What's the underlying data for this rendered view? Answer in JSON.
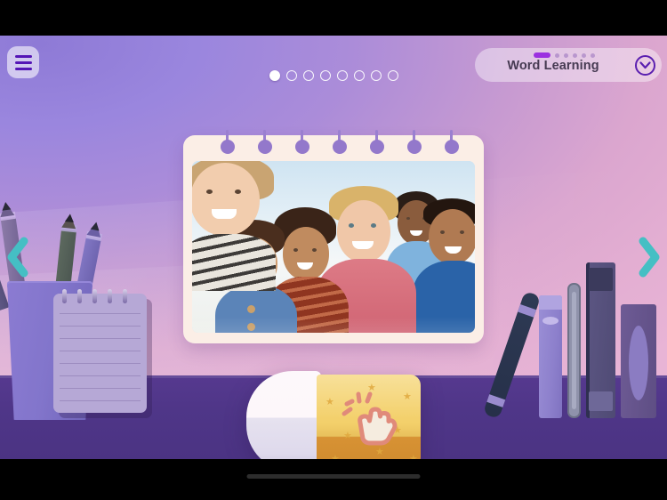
{
  "app": {
    "screen_name": "Word Learning flashcard",
    "background_wall_color": "#ab8cd9",
    "desk_color": "#4f3688",
    "accent_teal": "#45bfc4",
    "accent_purple": "#5415b6"
  },
  "statusbar": {
    "visible": true,
    "color": "#000000"
  },
  "header": {
    "menu_button": {
      "icon": "hamburger-icon",
      "label": "Menu"
    },
    "panel": {
      "title": "Word Learning",
      "chevron_icon": "chevron-down-circle-icon",
      "progress_segments": 6,
      "progress_current": 1
    }
  },
  "pagination": {
    "total": 8,
    "current": 1,
    "dots": [
      {
        "index": 1,
        "active": true
      },
      {
        "index": 2,
        "active": false
      },
      {
        "index": 3,
        "active": false
      },
      {
        "index": 4,
        "active": false
      },
      {
        "index": 5,
        "active": false
      },
      {
        "index": 6,
        "active": false
      },
      {
        "index": 7,
        "active": false
      },
      {
        "index": 8,
        "active": false
      }
    ]
  },
  "navigation": {
    "prev": {
      "icon": "chevron-left-icon",
      "label": "Previous card",
      "color": "#45bfc4"
    },
    "next": {
      "icon": "chevron-right-icon",
      "label": "Next card",
      "color": "#45bfc4"
    }
  },
  "flashcard": {
    "card_color": "#fbeee6",
    "spiral_rings": 7,
    "image_alt": "Six smiling children of mixed ethnicities posing closely together outdoors under a bright sky",
    "word_label": "",
    "kids": [
      {
        "name": "girl-blonde-striped-top",
        "shirt": "#e8e4dc"
      },
      {
        "name": "girl-denim-overalls",
        "shirt": "#5b84b8"
      },
      {
        "name": "child-red-striped-shirt",
        "shirt": "#8f3520"
      },
      {
        "name": "boy-pink-tshirt",
        "shirt": "#d96a78"
      },
      {
        "name": "boy-back-row-blue",
        "shirt": "#7fb3dd"
      },
      {
        "name": "boy-blue-tshirt",
        "shirt": "#2a63a8"
      }
    ]
  },
  "tap_card": {
    "label": "Tap to reveal",
    "icon": "tap-hand-pointer-icon",
    "eraser_body_color": "#fdf8fb",
    "sleeve_color": "#f3d06b",
    "sleeve_bottom_color": "#d79234"
  },
  "desk_props": {
    "pencil_cup": {
      "name": "pencil-cup",
      "pencil_count": 4
    },
    "notepad": {
      "name": "spiral-notepad",
      "ring_count": 5,
      "line_count": 8
    },
    "books": {
      "name": "book-stack",
      "count": 4
    },
    "marker": {
      "name": "marker-pen"
    }
  },
  "home_indicator": {
    "visible": true
  }
}
